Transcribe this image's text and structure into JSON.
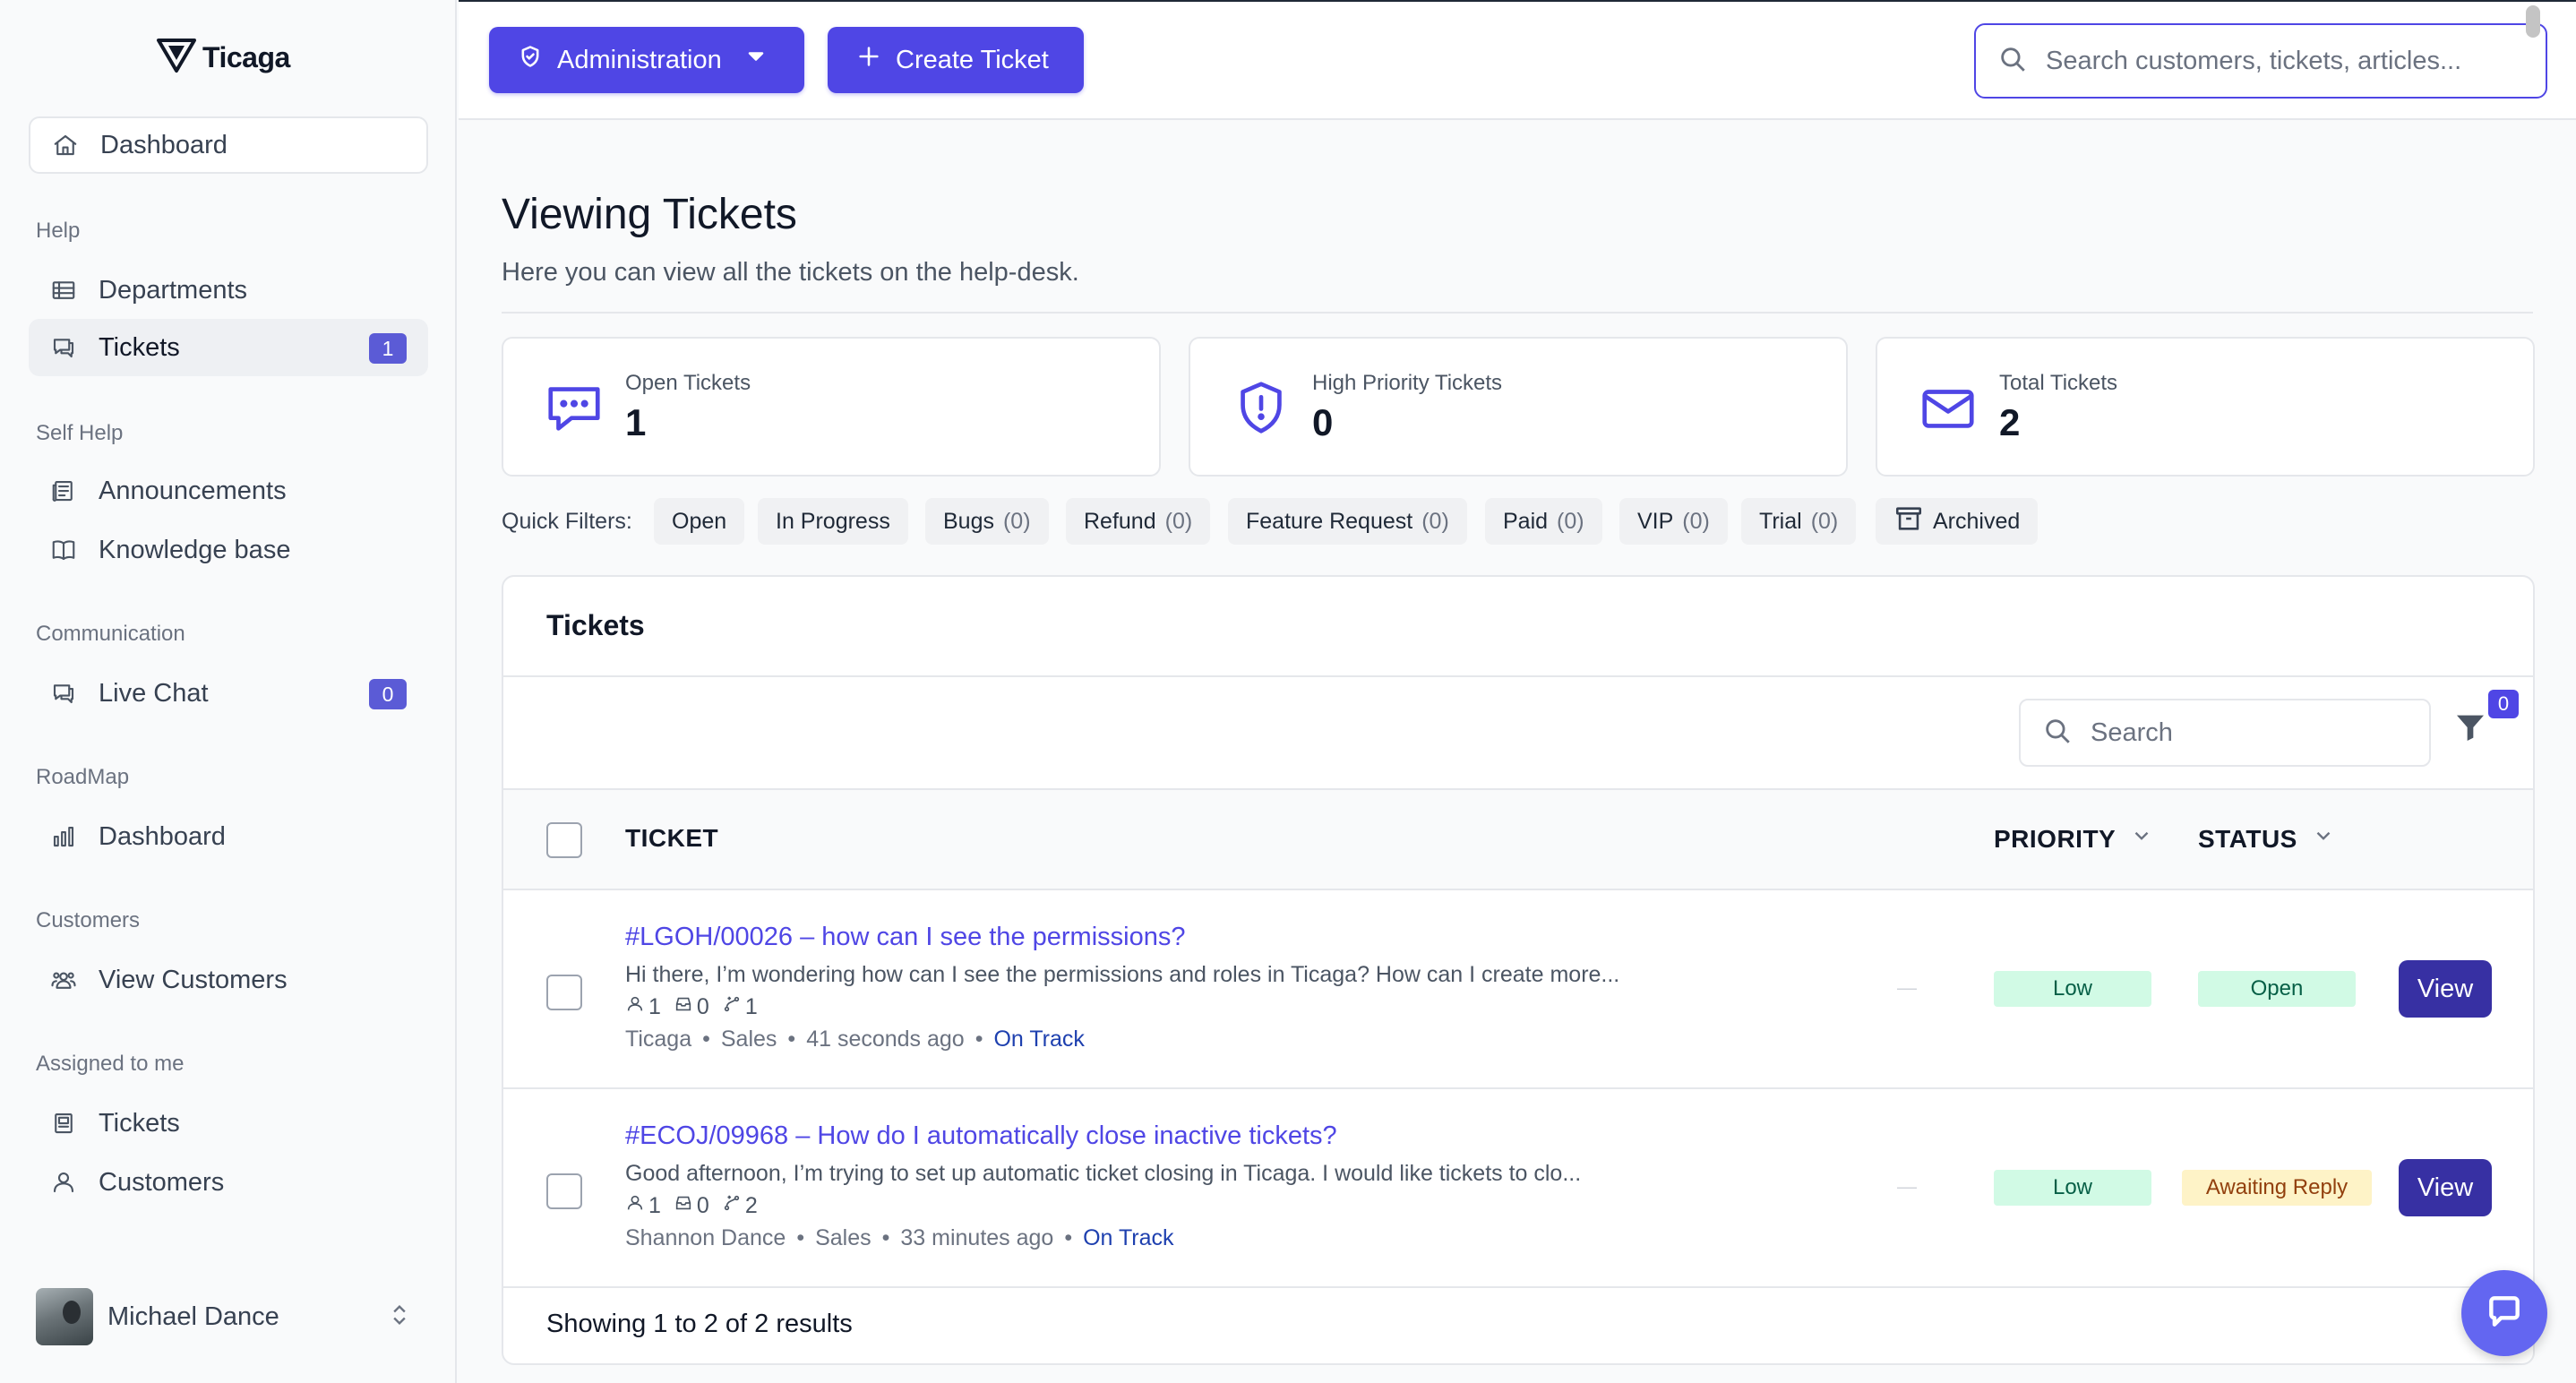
{
  "app": {
    "logo_text": "Ticaga"
  },
  "sidebar": {
    "dashboard": "Dashboard",
    "sections": [
      {
        "title": "Help",
        "items": [
          {
            "label": "Departments",
            "icon": "table-icon"
          },
          {
            "label": "Tickets",
            "icon": "chat-icon",
            "badge": "1"
          }
        ]
      },
      {
        "title": "Self Help",
        "items": [
          {
            "label": "Announcements",
            "icon": "newspaper-icon"
          },
          {
            "label": "Knowledge base",
            "icon": "book-icon"
          }
        ]
      },
      {
        "title": "Communication",
        "items": [
          {
            "label": "Live Chat",
            "icon": "chat-icon",
            "badge": "0"
          }
        ]
      },
      {
        "title": "RoadMap",
        "items": [
          {
            "label": "Dashboard",
            "icon": "bar-chart-icon"
          }
        ]
      },
      {
        "title": "Customers",
        "items": [
          {
            "label": "View Customers",
            "icon": "users-icon"
          }
        ]
      },
      {
        "title": "Assigned to me",
        "items": [
          {
            "label": "Tickets",
            "icon": "ticket-icon"
          },
          {
            "label": "Customers",
            "icon": "user-icon"
          }
        ]
      }
    ],
    "user": {
      "name": "Michael Dance"
    }
  },
  "topbar": {
    "admin_label": "Administration",
    "create_label": "Create Ticket",
    "search_placeholder": "Search customers, tickets, articles..."
  },
  "page": {
    "title": "Viewing Tickets",
    "subtitle": "Here you can view all the tickets on the help-desk."
  },
  "stats": [
    {
      "label": "Open Tickets",
      "value": "1",
      "icon": "chat-dots-icon"
    },
    {
      "label": "High Priority Tickets",
      "value": "0",
      "icon": "shield-alert-icon"
    },
    {
      "label": "Total Tickets",
      "value": "2",
      "icon": "envelope-icon"
    }
  ],
  "quick_filters": {
    "label": "Quick Filters:",
    "chips": [
      {
        "label": "Open",
        "count": ""
      },
      {
        "label": "In Progress",
        "count": ""
      },
      {
        "label": "Bugs",
        "count": "(0)"
      },
      {
        "label": "Refund",
        "count": "(0)"
      },
      {
        "label": "Feature Request",
        "count": "(0)"
      },
      {
        "label": "Paid",
        "count": "(0)"
      },
      {
        "label": "VIP",
        "count": "(0)"
      },
      {
        "label": "Trial",
        "count": "(0)"
      },
      {
        "label": "Archived",
        "count": ""
      }
    ]
  },
  "table": {
    "title": "Tickets",
    "search_placeholder": "Search",
    "filter_count": "0",
    "columns": {
      "ticket": "TICKET",
      "priority": "PRIORITY",
      "status": "STATUS"
    },
    "rows": [
      {
        "title": "#LGOH/00026 – how can I see the permissions?",
        "desc": "Hi there, I’m wondering how can I see the permissions and roles in Ticaga? How can I create more...",
        "users": "1",
        "files": "0",
        "replies": "1",
        "company": "Ticaga",
        "department": "Sales",
        "time": "41 seconds ago",
        "sla": "On Track",
        "dash": "—",
        "priority": "Low",
        "status": "Open",
        "action": "View"
      },
      {
        "title": "#ECOJ/09968 – How do I automatically close inactive tickets?",
        "desc": "Good afternoon, I’m trying to set up automatic ticket closing in Ticaga. I would like tickets to clo...",
        "users": "1",
        "files": "0",
        "replies": "2",
        "company": "Shannon Dance",
        "department": "Sales",
        "time": "33 minutes ago",
        "sla": "On Track",
        "dash": "—",
        "priority": "Low",
        "status": "Awaiting Reply",
        "action": "View"
      }
    ],
    "footer": "Showing 1 to 2 of 2 results"
  },
  "colors": {
    "primary": "#4f46e5",
    "badge": "#5b5bd6",
    "success_bg": "#d1fae5",
    "warning_bg": "#fef3c7"
  }
}
